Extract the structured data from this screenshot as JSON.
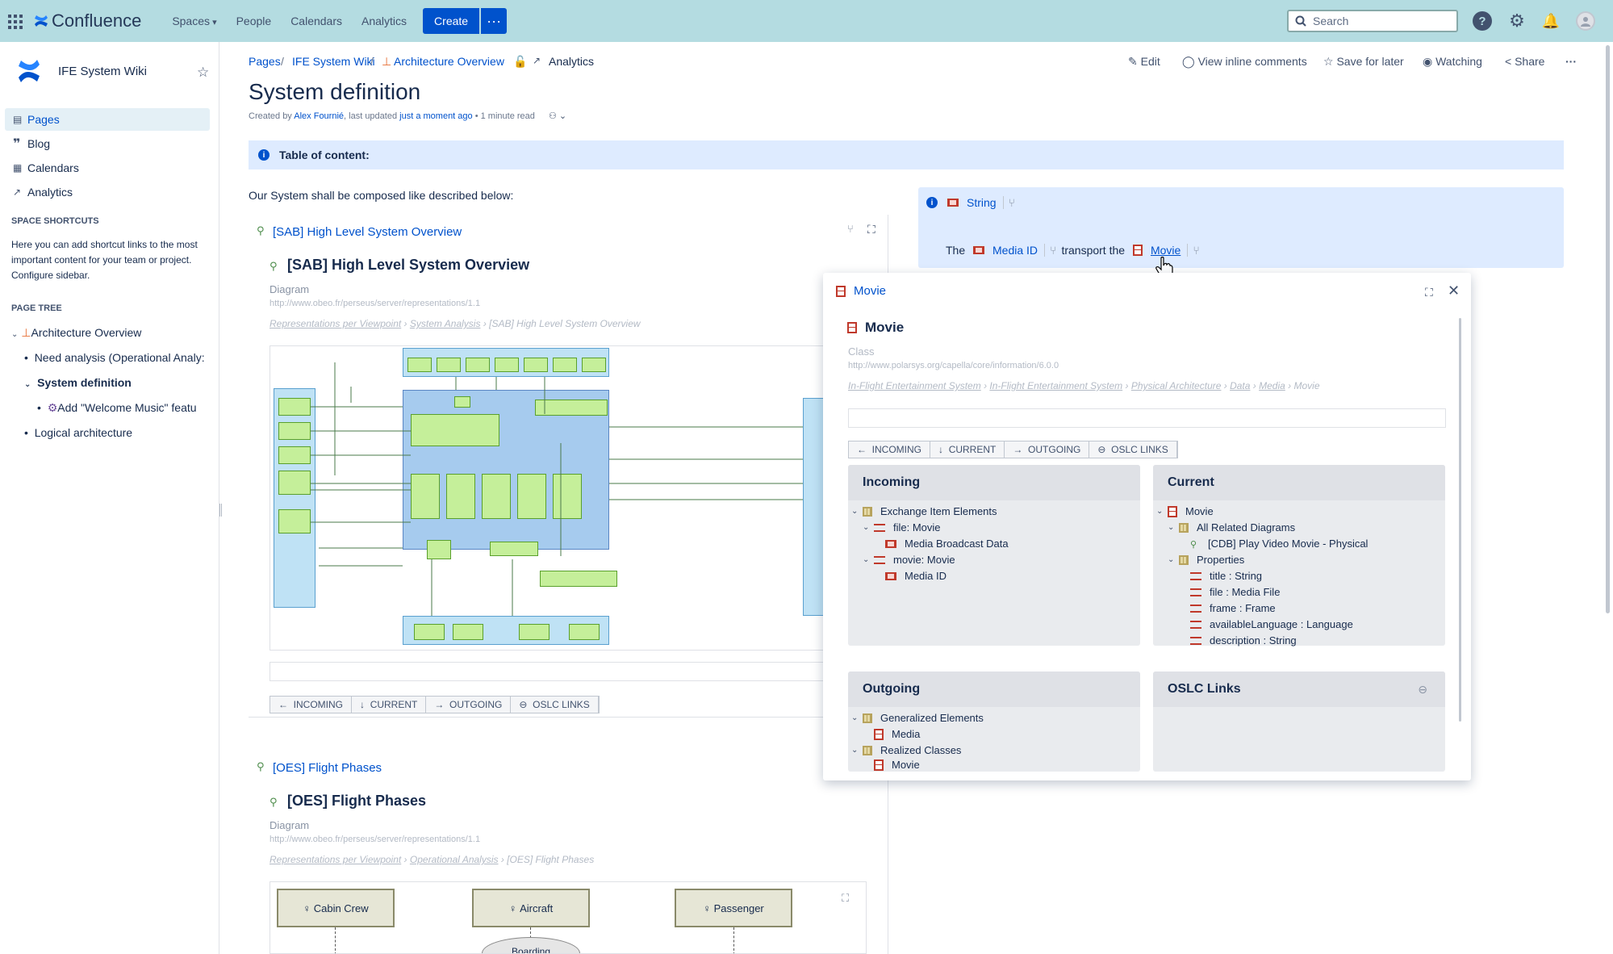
{
  "topnav": {
    "logo": "Confluence",
    "spaces": "Spaces",
    "people": "People",
    "calendars": "Calendars",
    "analytics": "Analytics",
    "create": "Create",
    "more": "···",
    "search_placeholder": "Search"
  },
  "sidebar": {
    "space_name": "IFE System Wiki",
    "nav": [
      "Pages",
      "Blog",
      "Calendars",
      "Analytics"
    ],
    "shortcuts_heading": "SPACE SHORTCUTS",
    "shortcuts_text": "Here you can add shortcut links to the most important content for your team or project.",
    "configure": "Configure sidebar.",
    "tree_heading": "PAGE TREE",
    "tree": [
      "Architecture Overview",
      "Need analysis (Operational Analy:",
      "System definition",
      "Add \"Welcome Music\" featu",
      "Logical architecture"
    ]
  },
  "breadcrumb": {
    "pages": "Pages",
    "wiki": "IFE System Wiki",
    "arch": "Architecture Overview",
    "analytics": "Analytics"
  },
  "actions": {
    "edit": "Edit",
    "comments": "View inline comments",
    "save": "Save for later",
    "watching": "Watching",
    "share": "Share",
    "more": "···"
  },
  "page": {
    "title": "System definition",
    "byline_prefix": "Created by",
    "author": "Alex Fournié",
    "byline_mid": ", last updated",
    "updated": "just a moment ago",
    "read": "• 1 minute read",
    "toc": "Table of content:",
    "intro": "Our System shall be composed like described below:"
  },
  "sab": {
    "link": "[SAB] High Level System Overview",
    "title": "[SAB] High Level System Overview",
    "kind": "Diagram",
    "url": "http://www.obeo.fr/perseus/server/representations/1.1",
    "path": [
      "Representations per Viewpoint",
      "System Analysis",
      "[SAB] High Level System Overview"
    ]
  },
  "oes": {
    "link": "[OES] Flight Phases",
    "title": "[OES] Flight Phases",
    "kind": "Diagram",
    "url": "http://www.obeo.fr/perseus/server/representations/1.1",
    "path": [
      "Representations per Viewpoint",
      "Operational Analysis",
      "[OES] Flight Phases"
    ],
    "actors": [
      "Cabin Crew",
      "Aircraft",
      "Passenger"
    ],
    "usecase": "Boarding"
  },
  "tabs": [
    "INCOMING",
    "CURRENT",
    "OUTGOING",
    "OSLC LINKS"
  ],
  "info_panel": {
    "string": "String",
    "the": "The",
    "media_id": "Media ID",
    "transport": "transport the",
    "movie": "Movie"
  },
  "popup": {
    "header": "Movie",
    "title": "Movie",
    "kind": "Class",
    "url": "http://www.polarsys.org/capella/core/information/6.0.0",
    "path": [
      "In-Flight Entertainment System",
      "In-Flight Entertainment System",
      "Physical Architecture",
      "Data",
      "Media",
      "Movie"
    ],
    "incoming": {
      "title": "Incoming",
      "items": [
        "Exchange Item Elements",
        "file: Movie",
        "Media Broadcast Data",
        "movie: Movie",
        "Media ID"
      ]
    },
    "current": {
      "title": "Current",
      "items": [
        "Movie",
        "All Related Diagrams",
        "[CDB] Play Video Movie - Physical",
        "Properties",
        "title : String",
        "file : Media File",
        "frame : Frame",
        "availableLanguage : Language",
        "description : String"
      ]
    },
    "outgoing": {
      "title": "Outgoing",
      "items": [
        "Generalized Elements",
        "Media",
        "Realized Classes",
        "Movie"
      ]
    },
    "oslc": {
      "title": "OSLC Links"
    }
  }
}
